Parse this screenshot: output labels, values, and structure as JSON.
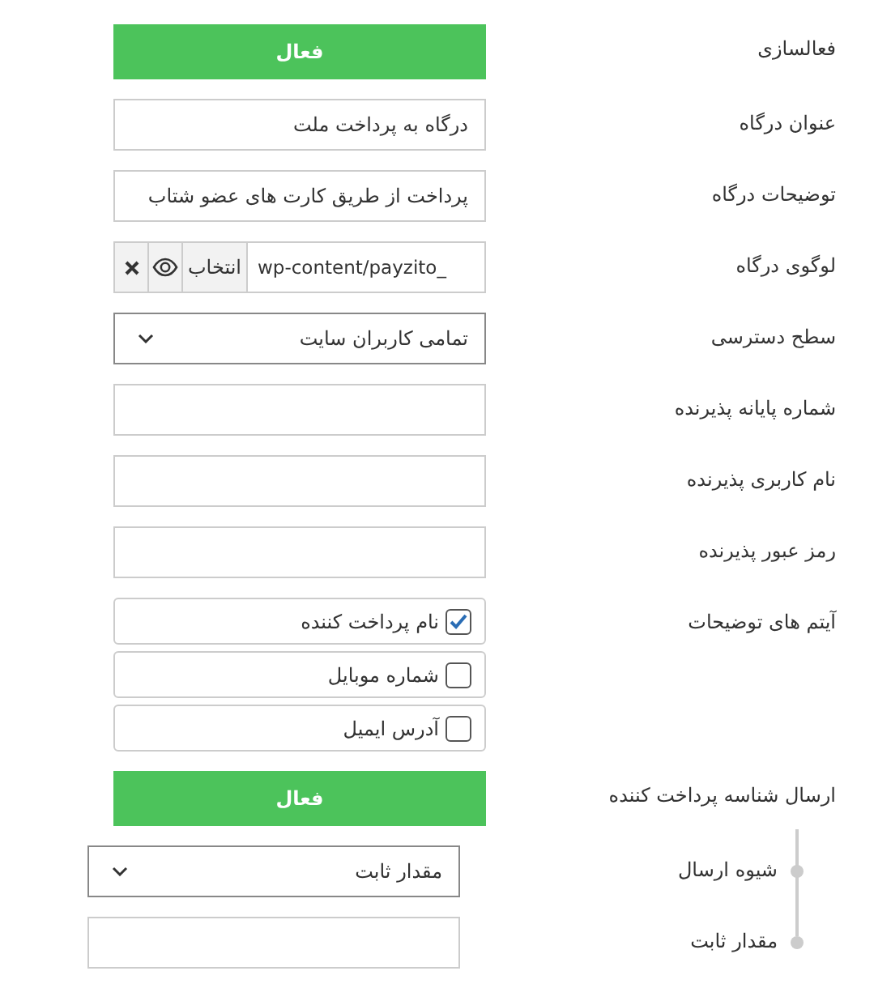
{
  "fields": [
    {
      "kind": "toggle",
      "label": "فعالسازی",
      "value": "فعال",
      "on": true
    },
    {
      "kind": "text",
      "label": "عنوان درگاه",
      "value": "درگاه به پرداخت ملت"
    },
    {
      "kind": "text",
      "label": "توضیحات درگاه",
      "value": "پرداخت از طریق کارت های عضو شتاب"
    },
    {
      "kind": "file",
      "label": "لوگوی درگاه",
      "value": "wp-content/payzito_",
      "button": "انتخاب"
    },
    {
      "kind": "select",
      "label": "سطح دسترسی",
      "value": "تمامی کاربران سایت"
    },
    {
      "kind": "text",
      "label": "شماره پایانه پذیرنده"
    },
    {
      "kind": "text",
      "label": "نام کاربری پذیرنده"
    },
    {
      "kind": "text",
      "label": "رمز عبور پذیرنده"
    },
    {
      "kind": "checklist",
      "label": "آیتم های توضیحات",
      "options": [
        {
          "label": "نام پرداخت کننده",
          "checked": true
        },
        {
          "label": "شماره موبایل",
          "checked": false
        },
        {
          "label": "آدرس ایمیل",
          "checked": false
        }
      ]
    },
    {
      "kind": "toggle",
      "label": "ارسال شناسه پرداخت کننده",
      "value": "فعال",
      "on": true,
      "children": [
        {
          "kind": "select",
          "label": "شیوه ارسال",
          "value": "مقدار ثابت"
        },
        {
          "kind": "text",
          "label": "مقدار ثابت"
        }
      ]
    }
  ]
}
